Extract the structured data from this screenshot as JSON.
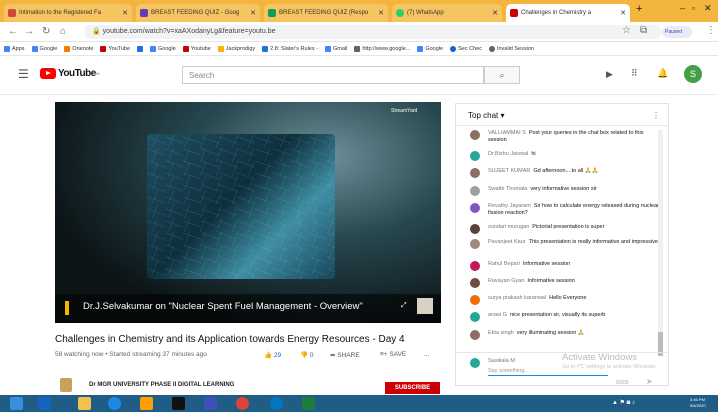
{
  "browser": {
    "tabs": [
      {
        "label": "Intimation to the Registered Fa",
        "icon": "gmail-icon",
        "color": "#d14836"
      },
      {
        "label": "BREAST FEEDING QUIZ - Goog",
        "icon": "forms-icon",
        "color": "#673ab7"
      },
      {
        "label": "BREAST FEEDING QUIZ (Respo",
        "icon": "sheets-icon",
        "color": "#0f9d58"
      },
      {
        "label": "(7) WhatsApp",
        "icon": "whatsapp-icon",
        "color": "#25d366"
      },
      {
        "label": "Challenges in Chemistry a",
        "icon": "youtube-icon",
        "color": "#cc0000"
      }
    ],
    "new_tab": "+",
    "url": "youtube.com/watch?v=xaAXodanyLg&feature=youtu.be",
    "paused_label": "Paused",
    "bookmarks": [
      "Apps",
      "Google",
      "Onenote",
      "YouTube",
      "",
      "Google",
      "Youtube",
      "Jackprodigy",
      "2.8: Slater's Rules -",
      "Gmail",
      "http://www.google...",
      "Google",
      "Sec Chec",
      "Invalid Session"
    ]
  },
  "youtube": {
    "logo_text": "YouTube",
    "logo_sup": "IN",
    "search_placeholder": "Search",
    "avatar_letter": "S",
    "video": {
      "overlay_badge": "StreamYard",
      "overlay_caption": "Dr.J.Selvakumar on \"Nuclear Spent Fuel Management - Overview\"",
      "title": "Challenges in Chemistry and its Application towards Energy Resources - Day 4",
      "meta": "58 watching now • Started streaming 37 minutes ago",
      "likes": "29",
      "dislikes": "0",
      "share_label": "SHARE",
      "save_label": "SAVE",
      "more_label": "...",
      "channel": "Dr MGR UNIVERSITY PHASE II DIGITAL LEARNING",
      "subscribe_label": "SUBSCRIBE"
    },
    "chat": {
      "header": "Top chat ▾",
      "messages": [
        {
          "author": "VALLIAMMAI S",
          "text": "Post your queries in the chat box related to this session",
          "color": "#8d6e63"
        },
        {
          "author": "Dr.Bishu Jaiswal",
          "text": "hi",
          "color": "#26a69a"
        },
        {
          "author": "SUJEET KUMAR",
          "text": "Gd afternoon....to all 🙏🙏",
          "color": "#8d6e63"
        },
        {
          "author": "Swathi Thomala",
          "text": "very informative session sir",
          "color": "#9e9e9e"
        },
        {
          "author": "Revathy Jayaram",
          "text": "Sir how to calculate energy released during nuclear fission reaction?",
          "color": "#7e57c2"
        },
        {
          "author": "sundari murugan",
          "text": "Pictorial presentation is super",
          "color": "#5d4037"
        },
        {
          "author": "Pavanjeet Kaur",
          "text": "This presentation is really informative and impressive",
          "color": "#a1887f"
        },
        {
          "author": "Rahul Bepari",
          "text": "Informative session",
          "color": "#c2185b"
        },
        {
          "author": "Ravayan Gyan",
          "text": "Informative session",
          "color": "#6d4c41"
        },
        {
          "author": "surya prakash karanwal",
          "text": "Hello Everyone",
          "color": "#ef6c00"
        },
        {
          "author": "anasi G",
          "text": "nice presentation sir, visually its superb",
          "color": "#26a69a"
        },
        {
          "author": "Ekta singh",
          "text": "very illuminating session 🙏",
          "color": "#8d6e63"
        }
      ],
      "input_author": "Sasikala M",
      "input_placeholder": "Say something...",
      "char_count": "0/200"
    }
  },
  "windows_watermark": {
    "title": "Activate Windows",
    "subtitle": "Go to PC settings to activate Windows"
  },
  "taskbar": {
    "time": "3:46 PM",
    "date": "5/6/2020"
  }
}
